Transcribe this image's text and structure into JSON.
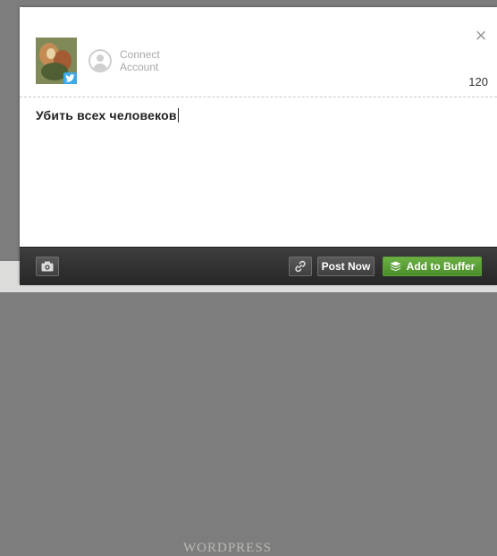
{
  "profile": {
    "network_icon": "twitter-icon",
    "connect_label_line1": "Connect",
    "connect_label_line2": "Account"
  },
  "composer": {
    "char_count": "120",
    "text": "Убить всех человеков"
  },
  "toolbar": {
    "camera_icon": "camera-icon",
    "link_icon": "link-icon",
    "post_now_label": "Post Now",
    "add_to_buffer_label": "Add to Buffer"
  },
  "background": {
    "partial_text": "WORDPRESS"
  },
  "colors": {
    "toolbar": "#2f2f2f",
    "buffer_green": "#5a9f35",
    "twitter_blue": "#3ea9e6"
  }
}
